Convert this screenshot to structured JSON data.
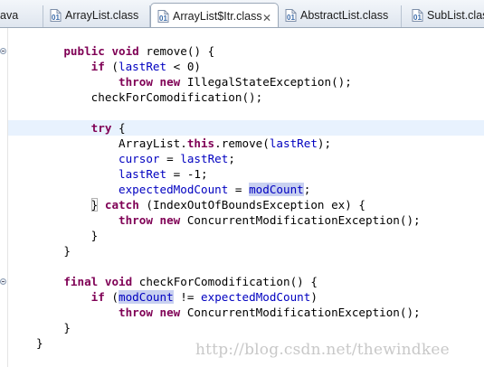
{
  "tabs": [
    {
      "label": "ava",
      "icon": "java-file-icon",
      "active": false
    },
    {
      "label": "ArrayList.class",
      "icon": "class-file-icon",
      "active": false
    },
    {
      "label": "ArrayList$Itr.class",
      "icon": "class-file-icon",
      "active": true,
      "close": "✕"
    },
    {
      "label": "AbstractList.class",
      "icon": "class-file-icon",
      "active": false
    },
    {
      "label": "SubList.class",
      "icon": "class-file-icon",
      "active": false
    }
  ],
  "code": {
    "lines": [
      [
        {
          "t": "    "
        },
        {
          "t": "public",
          "c": "kw"
        },
        {
          "t": " "
        },
        {
          "t": "void",
          "c": "kw"
        },
        {
          "t": " remove() {"
        }
      ],
      [
        {
          "t": "        "
        },
        {
          "t": "if",
          "c": "kw"
        },
        {
          "t": " ("
        },
        {
          "t": "lastRet",
          "c": "fld"
        },
        {
          "t": " < 0)"
        }
      ],
      [
        {
          "t": "            "
        },
        {
          "t": "throw",
          "c": "kw"
        },
        {
          "t": " "
        },
        {
          "t": "new",
          "c": "kw"
        },
        {
          "t": " IllegalStateException();"
        }
      ],
      [
        {
          "t": "        checkForComodification();"
        }
      ],
      [],
      [
        {
          "t": "        "
        },
        {
          "t": "try",
          "c": "kw"
        },
        {
          "t": " {"
        }
      ],
      [
        {
          "t": "            ArrayList."
        },
        {
          "t": "this",
          "c": "kw"
        },
        {
          "t": ".remove("
        },
        {
          "t": "lastRet",
          "c": "fld"
        },
        {
          "t": ");"
        }
      ],
      [
        {
          "t": "            "
        },
        {
          "t": "cursor",
          "c": "fld"
        },
        {
          "t": " = "
        },
        {
          "t": "lastRet",
          "c": "fld"
        },
        {
          "t": ";"
        }
      ],
      [
        {
          "t": "            "
        },
        {
          "t": "lastRet",
          "c": "fld"
        },
        {
          "t": " = -1;"
        }
      ],
      [
        {
          "t": "            "
        },
        {
          "t": "expectedModCount",
          "c": "fld"
        },
        {
          "t": " = "
        },
        {
          "t": "modCount",
          "c": "fld hl"
        },
        {
          "t": ";"
        }
      ],
      [
        {
          "t": "        "
        },
        {
          "t": "}",
          "c": "brk"
        },
        {
          "t": " "
        },
        {
          "t": "catch",
          "c": "kw"
        },
        {
          "t": " (IndexOutOfBoundsException ex) {"
        }
      ],
      [
        {
          "t": "            "
        },
        {
          "t": "throw",
          "c": "kw"
        },
        {
          "t": " "
        },
        {
          "t": "new",
          "c": "kw"
        },
        {
          "t": " ConcurrentModificationException();"
        }
      ],
      [
        {
          "t": "        }"
        }
      ],
      [
        {
          "t": "    }"
        }
      ],
      [],
      [
        {
          "t": "    "
        },
        {
          "t": "final",
          "c": "kw"
        },
        {
          "t": " "
        },
        {
          "t": "void",
          "c": "kw"
        },
        {
          "t": " checkForComodification() {"
        }
      ],
      [
        {
          "t": "        "
        },
        {
          "t": "if",
          "c": "kw"
        },
        {
          "t": " ("
        },
        {
          "t": "modCount",
          "c": "fld hl"
        },
        {
          "t": " != "
        },
        {
          "t": "expectedModCount",
          "c": "fld"
        },
        {
          "t": ")"
        }
      ],
      [
        {
          "t": "            "
        },
        {
          "t": "throw",
          "c": "kw"
        },
        {
          "t": " "
        },
        {
          "t": "new",
          "c": "kw"
        },
        {
          "t": " ConcurrentModificationException();"
        }
      ],
      [
        {
          "t": "    }"
        }
      ],
      [
        {
          "t": "}"
        }
      ]
    ]
  },
  "watermark": "http://blog.csdn.net/thewindkee",
  "colors": {
    "keyword": "#7f0055",
    "field": "#0000c0",
    "occurrence_highlight": "#c8d0f0",
    "current_line": "#e8f2fe"
  }
}
